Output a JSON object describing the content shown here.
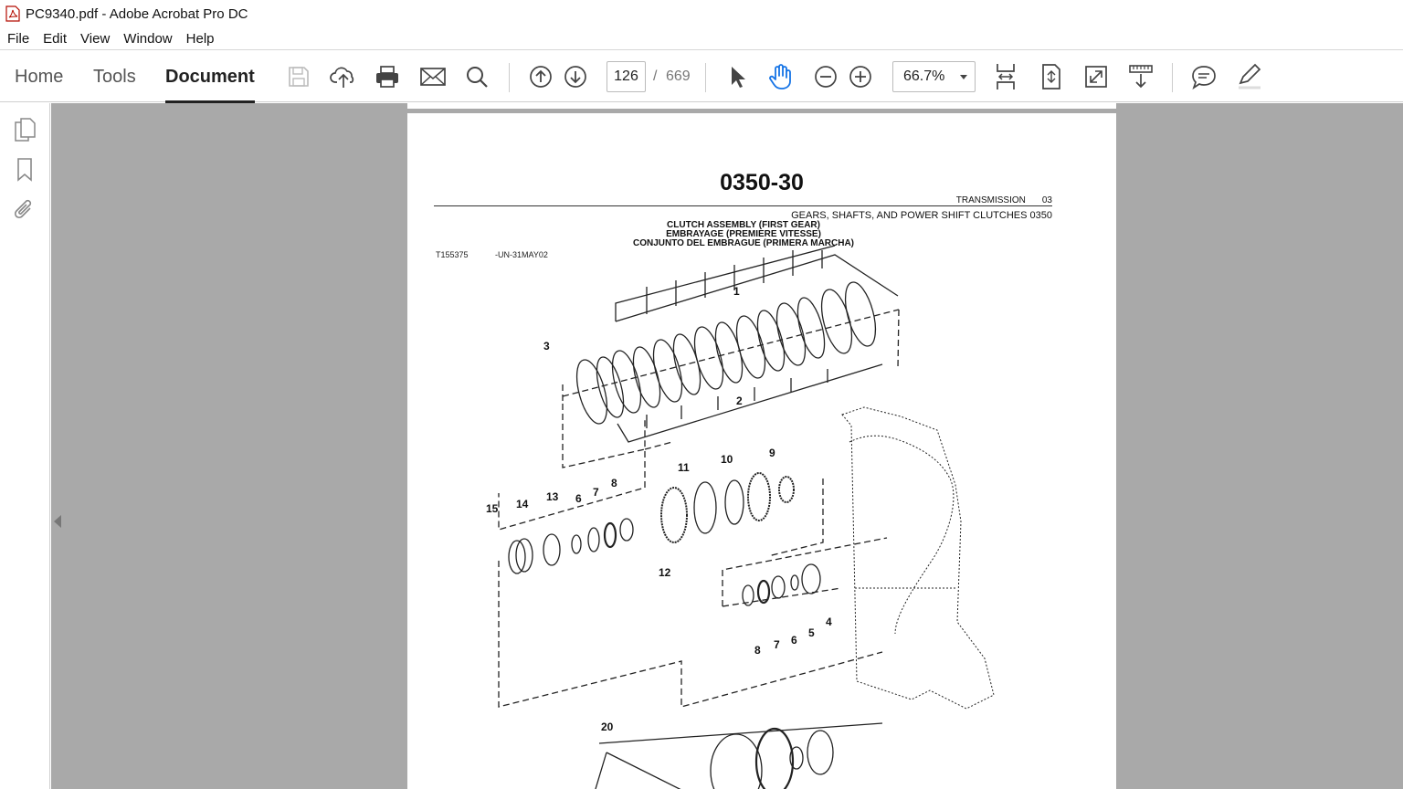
{
  "window": {
    "title": "PC9340.pdf - Adobe Acrobat Pro DC"
  },
  "menu": [
    "File",
    "Edit",
    "View",
    "Window",
    "Help"
  ],
  "nav_tabs": {
    "home": "Home",
    "tools": "Tools",
    "document": "Document"
  },
  "pager": {
    "current": "126",
    "separator": "/",
    "total": "669"
  },
  "zoom": {
    "value": "66.7%"
  },
  "doc": {
    "title": "0350-30",
    "section": "TRANSMISSION",
    "section_num": "03",
    "subsection": "GEARS, SHAFTS, AND POWER SHIFT CLUTCHES 0350",
    "heading_en": "CLUTCH ASSEMBLY (FIRST GEAR)",
    "heading_fr": "EMBRAYAGE (PREMIERE VITESSE)",
    "heading_es": "CONJUNTO DEL EMBRAGUE (PRIMERA MARCHA)",
    "ref_id": "T155375",
    "ref_code": "-UN-31MAY02"
  },
  "callouts": {
    "c1": "1",
    "c2": "2",
    "c3": "3",
    "c4": "4",
    "c5": "5",
    "c6a": "6",
    "c6b": "6",
    "c7a": "7",
    "c7b": "7",
    "c8a": "8",
    "c8b": "8",
    "c9": "9",
    "c10": "10",
    "c11": "11",
    "c12": "12",
    "c13": "13",
    "c14": "14",
    "c15": "15",
    "c20": "20"
  },
  "icons": {
    "save": "save-icon",
    "upload": "cloud-upload-icon",
    "print": "print-icon",
    "email": "mail-icon",
    "search": "search-icon",
    "prev": "prev-page-icon",
    "next": "next-page-icon",
    "select": "select-arrow-icon",
    "hand": "hand-icon",
    "zoom_out": "zoom-out-icon",
    "zoom_in": "zoom-in-icon"
  }
}
